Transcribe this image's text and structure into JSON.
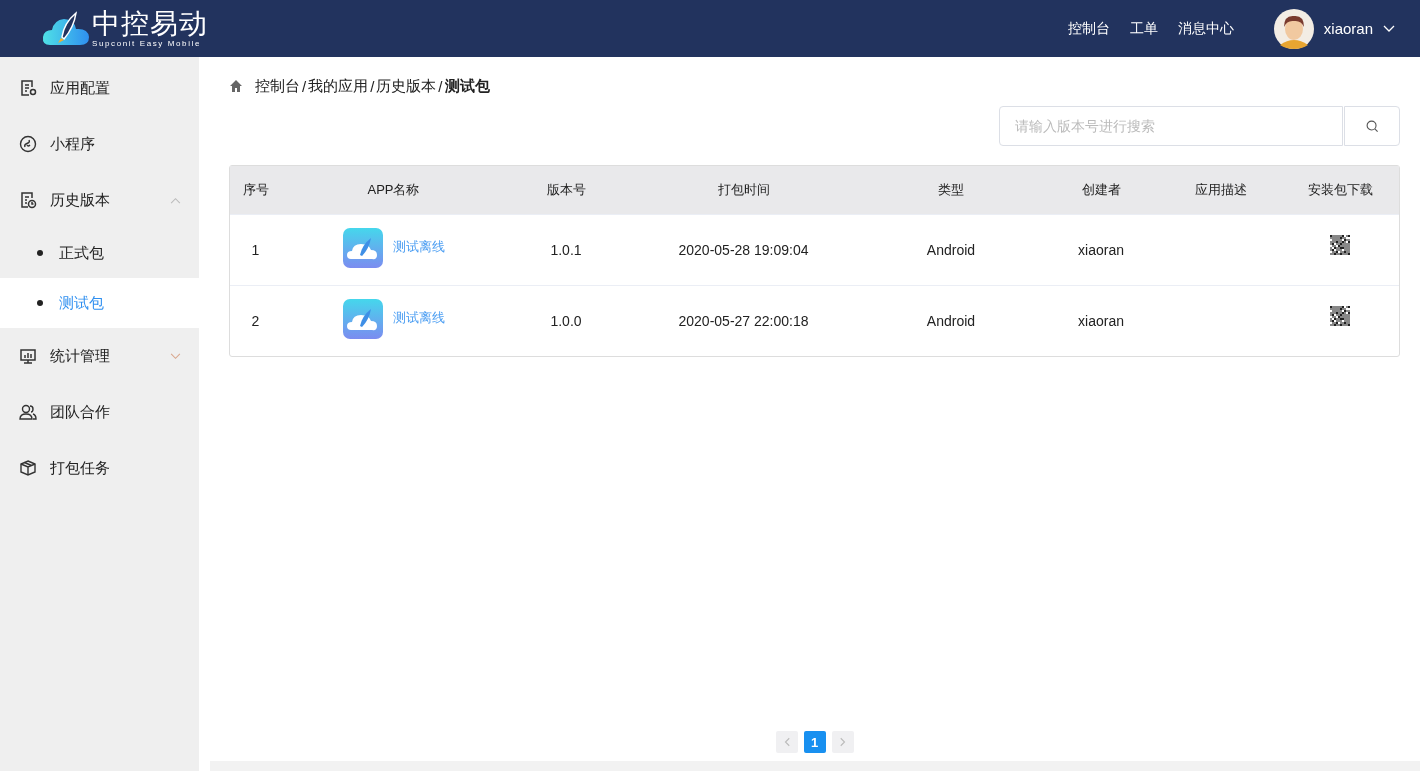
{
  "header": {
    "logo": {
      "title": "中控易动",
      "subtitle": "Supconit Easy Mobile"
    },
    "nav": [
      "控制台",
      "工单",
      "消息中心"
    ],
    "user": {
      "name": "xiaoran"
    }
  },
  "sidebar": {
    "items": [
      {
        "label": "应用配置"
      },
      {
        "label": "小程序"
      },
      {
        "label": "历史版本",
        "expanded": true,
        "children": [
          {
            "label": "正式包",
            "selected": false
          },
          {
            "label": "测试包",
            "selected": true
          }
        ]
      },
      {
        "label": "统计管理",
        "expanded": false
      },
      {
        "label": "团队合作"
      },
      {
        "label": "打包任务"
      }
    ]
  },
  "breadcrumb": {
    "separator": "/",
    "items": [
      "控制台",
      "我的应用",
      "历史版本",
      "测试包"
    ]
  },
  "search": {
    "placeholder": "请输入版本号进行搜索"
  },
  "table": {
    "columns": [
      "序号",
      "APP名称",
      "版本号",
      "打包时间",
      "类型",
      "创建者",
      "应用描述",
      "安装包下载"
    ],
    "rows": [
      {
        "index": "1",
        "app_name": "测试离线",
        "version": "1.0.1",
        "time": "2020-05-28 19:09:04",
        "type": "Android",
        "creator": "xiaoran"
      },
      {
        "index": "2",
        "app_name": "测试离线",
        "version": "1.0.0",
        "time": "2020-05-27 22:00:18",
        "type": "Android",
        "creator": "xiaoran"
      }
    ]
  },
  "pagination": {
    "pages": [
      {
        "label": "1",
        "selected": true
      }
    ]
  }
}
